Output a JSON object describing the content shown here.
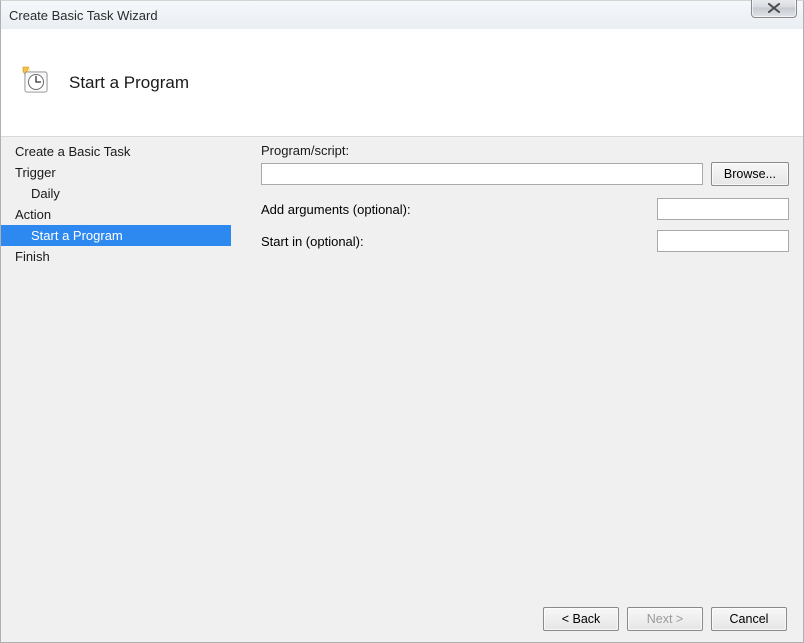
{
  "window": {
    "title": "Create Basic Task Wizard"
  },
  "header": {
    "heading": "Start a Program"
  },
  "sidebar": {
    "items": [
      {
        "label": "Create a Basic Task",
        "sub": false,
        "selected": false
      },
      {
        "label": "Trigger",
        "sub": false,
        "selected": false
      },
      {
        "label": "Daily",
        "sub": true,
        "selected": false
      },
      {
        "label": "Action",
        "sub": false,
        "selected": false
      },
      {
        "label": "Start a Program",
        "sub": true,
        "selected": true
      },
      {
        "label": "Finish",
        "sub": false,
        "selected": false
      }
    ]
  },
  "form": {
    "program_label": "Program/script:",
    "program_value": "",
    "browse_label": "Browse...",
    "args_label": "Add arguments (optional):",
    "args_value": "",
    "startin_label": "Start in (optional):",
    "startin_value": ""
  },
  "footer": {
    "back_label": "< Back",
    "next_label": "Next >",
    "cancel_label": "Cancel",
    "next_enabled": false
  }
}
